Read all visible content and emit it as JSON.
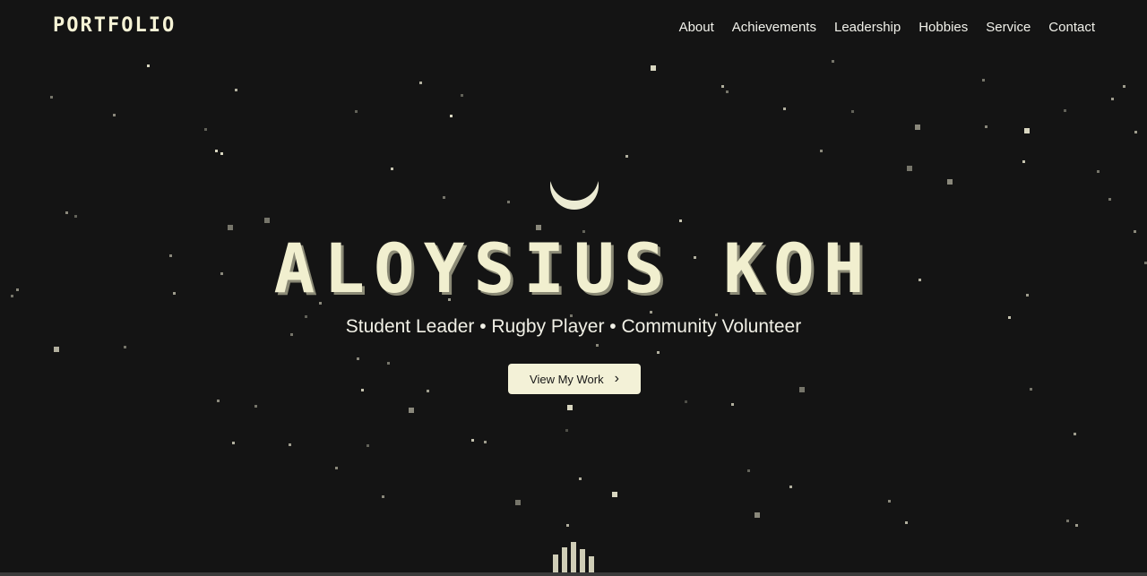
{
  "header": {
    "logo": "PORTFOLIO",
    "nav": [
      "About",
      "Achievements",
      "Leadership",
      "Hobbies",
      "Service",
      "Contact"
    ]
  },
  "hero": {
    "name": "ALOYSIUS KOH",
    "subtitle": "Student Leader • Rugby Player • Community Volunteer",
    "cta_label": "View My Work",
    "moon_icon": "crescent-moon-icon",
    "cta_icon": "chevron-right-icon",
    "scroll_icon": "equalizer-bars-icon"
  },
  "colors": {
    "background": "#141414",
    "accent": "#f3f1d7",
    "text": "#f1f0e6"
  }
}
